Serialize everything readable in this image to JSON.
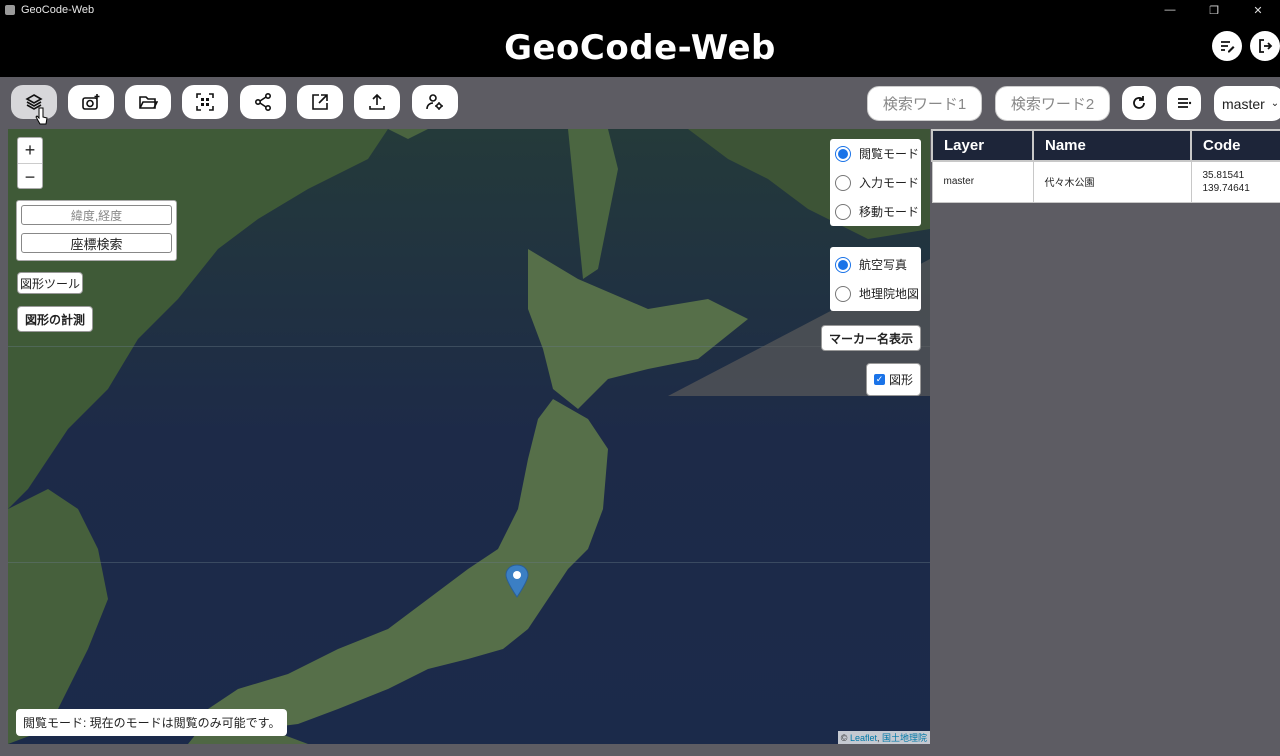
{
  "window": {
    "title": "GeoCode-Web"
  },
  "app": {
    "title": "GeoCode-Web"
  },
  "toolbar": {
    "buttons": [
      {
        "icon": "layers-icon"
      },
      {
        "icon": "camera-add-icon"
      },
      {
        "icon": "folder-open-icon"
      },
      {
        "icon": "qr-scan-icon"
      },
      {
        "icon": "share-icon"
      },
      {
        "icon": "external-link-icon"
      },
      {
        "icon": "upload-icon"
      },
      {
        "icon": "user-settings-icon"
      }
    ],
    "search1_placeholder": "検索ワード1",
    "search2_placeholder": "検索ワード2",
    "layer_select": "master"
  },
  "map": {
    "zoom_in": "+",
    "zoom_out": "−",
    "coord_placeholder": "緯度,経度",
    "coord_search": "座標検索",
    "shape_tool": "図形ツール",
    "shape_measure": "図形の計測",
    "modes": [
      "閲覧モード",
      "入力モード",
      "移動モード"
    ],
    "selected_mode": "閲覧モード",
    "basemaps": [
      "航空写真",
      "地理院地図"
    ],
    "selected_basemap": "航空写真",
    "marker_names": "マーカー名表示",
    "shapes_checkbox": "図形",
    "status": "閲覧モード: 現在のモードは閲覧のみ可能です。",
    "attribution_prefix": "© ",
    "attribution_leaflet": "Leaflet",
    "attribution_sep": ", ",
    "attribution_gsi": "国土地理院"
  },
  "table": {
    "headers": [
      "Layer",
      "Name",
      "Code"
    ],
    "rows": [
      {
        "layer": "master",
        "name": "代々木公園",
        "code_lat": "35.81541",
        "code_lng": "139.74641"
      }
    ]
  },
  "colors": {
    "header_bg": "#000000",
    "table_head": "#1d2539",
    "accent": "#1a73e8",
    "page_bg": "#5d5c63"
  }
}
